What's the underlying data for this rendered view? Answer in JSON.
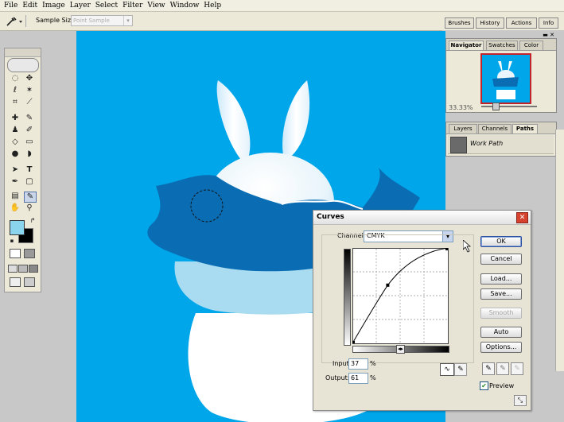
{
  "menu": [
    "File",
    "Edit",
    "Image",
    "Layer",
    "Select",
    "Filter",
    "View",
    "Window",
    "Help"
  ],
  "options_bar": {
    "sample_size_label": "Sample Size:",
    "sample_size_value": "Point Sample"
  },
  "palette_well_tabs": [
    "Brushes",
    "History",
    "Actions",
    "Info"
  ],
  "navigator_panel": {
    "tabs": [
      "Navigator",
      "Swatches",
      "Color"
    ],
    "zoom": "33.33%"
  },
  "layers_panel": {
    "tabs": [
      "Layers",
      "Channels",
      "Paths"
    ],
    "path_name": "Work Path"
  },
  "curves_dialog": {
    "title": "Curves",
    "channel_label": "Channel:",
    "channel_value": "CMYK",
    "input_label": "Input:",
    "input_value": "37",
    "input_unit": "%",
    "output_label": "Output:",
    "output_value": "61",
    "output_unit": "%",
    "buttons": {
      "ok": "OK",
      "cancel": "Cancel",
      "load": "Load...",
      "save": "Save...",
      "smooth": "Smooth",
      "auto": "Auto",
      "options": "Options..."
    },
    "preview_label": "Preview",
    "preview_checked": true,
    "curve_point": {
      "input_percent": 37,
      "output_percent": 61
    }
  },
  "colors": {
    "canvas": "#00a6ea",
    "foreground": "#8ad4ee",
    "background": "#000000",
    "dark_band": "#0a6db3",
    "light_band": "#a9dcf1",
    "body": "#ffffff"
  },
  "icons": [
    "eyedropper-icon",
    "marquee-icon",
    "move-icon",
    "lasso-icon",
    "magic-wand-icon",
    "crop-icon",
    "slice-icon",
    "healing-brush-icon",
    "brush-icon",
    "stamp-icon",
    "history-brush-icon",
    "eraser-icon",
    "gradient-icon",
    "blur-icon",
    "dodge-icon",
    "path-select-icon",
    "type-icon",
    "pen-icon",
    "shape-icon",
    "notes-icon",
    "hand-icon",
    "zoom-icon"
  ]
}
